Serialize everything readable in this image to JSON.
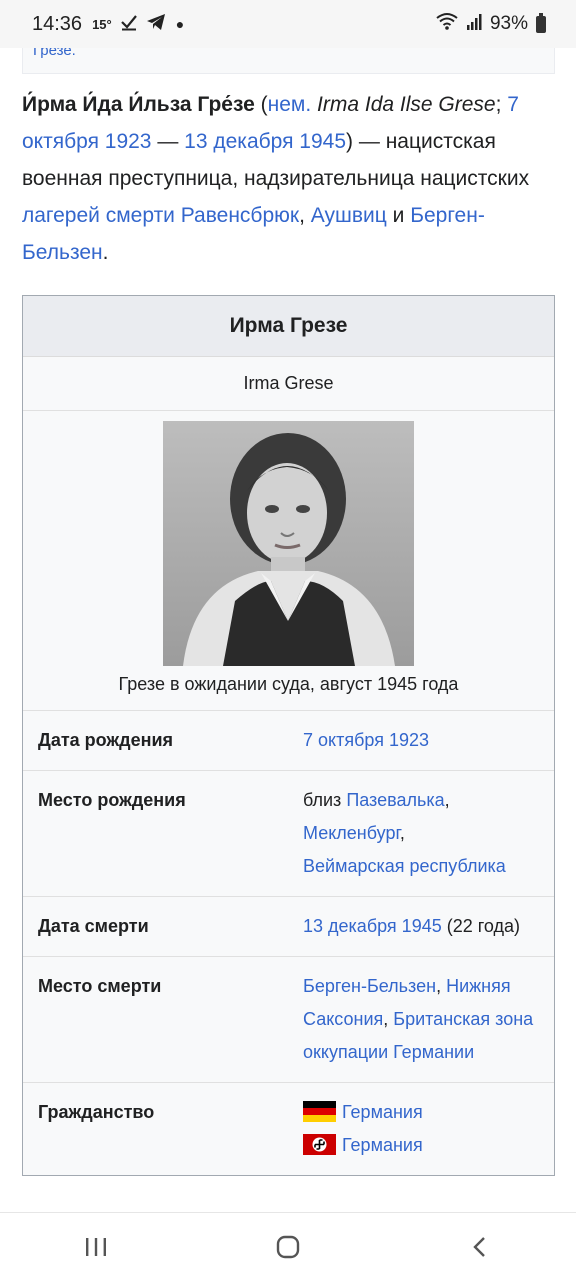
{
  "status_bar": {
    "time": "14:36",
    "temperature": "15°",
    "battery": "93%",
    "icons": [
      "check-icon",
      "telegram-icon",
      "dot-icon",
      "wifi-icon",
      "signal-icon",
      "battery-icon"
    ]
  },
  "top_fragment": {
    "text": "Грезе."
  },
  "lead": {
    "name": "И́рма И́да И́льза Гре́зе",
    "open_paren": " (",
    "lang_link": "нем.",
    "native_name": " Irma Ida Ilse Grese",
    "sep1": "; ",
    "birth_link": "7 октября 1923",
    "dash": " — ",
    "death_link": "13 декабря 1945",
    "rest1": ") — нацистская военная преступница, надзирательница нацистских ",
    "camps_link": "лагерей смерти Равенсбрюк",
    "comma1": ", ",
    "auschwitz_link": "Аушвиц",
    "and_text": " и ",
    "belsen_link": "Берген-Бельзен",
    "period": "."
  },
  "infobox": {
    "title": "Ирма Грезе",
    "original_name": "Irma Grese",
    "caption": "Грезе в ожидании суда, август 1945 года",
    "rows": [
      {
        "label": "Дата рождения",
        "value_link": "7 октября 1923"
      },
      {
        "label": "Место рождения",
        "prefix": "близ ",
        "link1": "Пазевалька",
        "sep1": ", ",
        "link2": "Мекленбург",
        "sep2": ", ",
        "link3": "Веймарская республика"
      },
      {
        "label": "Дата смерти",
        "value_link": "13 декабря 1945",
        "suffix": " (22 года)"
      },
      {
        "label": "Место смерти",
        "link1": "Берген-Бельзен",
        "sep1": ", ",
        "link2": "Нижняя Саксония",
        "sep2": ", ",
        "link3": "Британская зона оккупации Германии"
      },
      {
        "label": "Гражданство",
        "citizenship1": "Германия",
        "citizenship2": "Германия"
      }
    ]
  },
  "colors": {
    "link": "#3366cc",
    "infobox_header": "#eaecf0",
    "infobox_bg": "#f8f9fa"
  }
}
